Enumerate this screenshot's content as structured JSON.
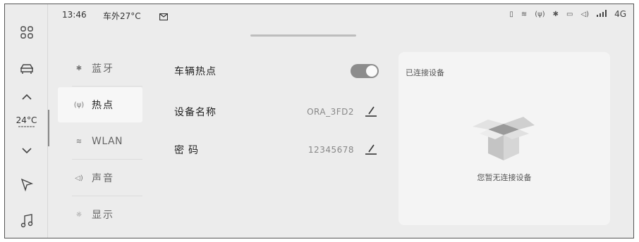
{
  "status": {
    "time": "13:46",
    "outside_temp": "车外27°C",
    "network": "4G"
  },
  "rail": {
    "temperature": "24°C"
  },
  "menu": {
    "items": [
      {
        "icon": "bluetooth-icon",
        "glyph": "✱",
        "label": "蓝牙"
      },
      {
        "icon": "hotspot-icon",
        "glyph": "(ψ)",
        "label": "热点"
      },
      {
        "icon": "wifi-icon",
        "glyph": "≋",
        "label": "WLAN"
      },
      {
        "icon": "volume-icon",
        "glyph": "◁)",
        "label": "声音"
      },
      {
        "icon": "brightness-icon",
        "glyph": "☼",
        "label": "显示"
      }
    ],
    "active_index": 1
  },
  "settings": {
    "hotspot_label": "车辆热点",
    "hotspot_enabled": true,
    "device_name_label": "设备名称",
    "device_name_value": "ORA_3FD2",
    "password_label": "密码",
    "password_value": "12345678"
  },
  "panel": {
    "title": "已连接设备",
    "empty_text": "您暂无连接设备"
  }
}
